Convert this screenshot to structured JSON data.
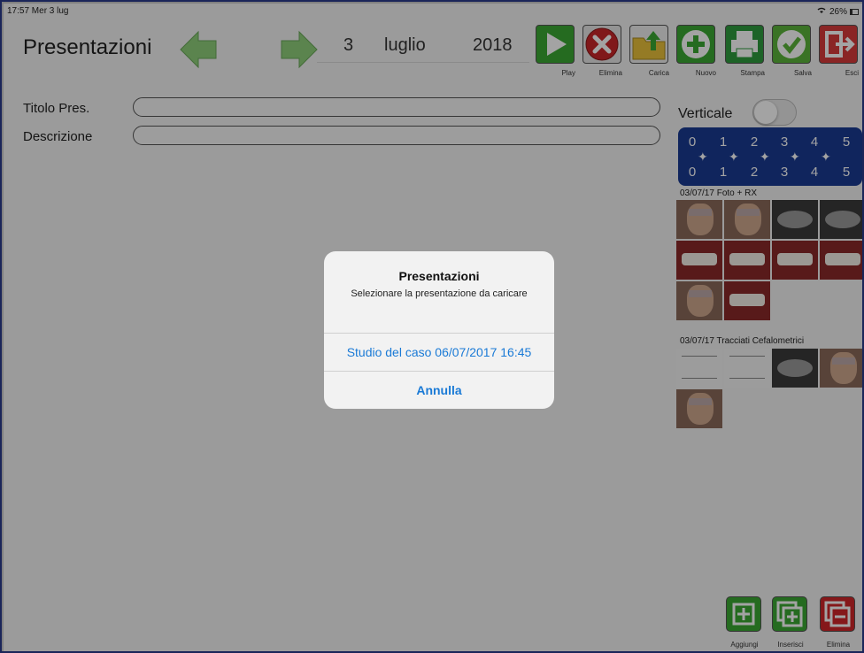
{
  "status": {
    "time_date": "17:57  Mer 3 lug",
    "battery": "26%"
  },
  "header": {
    "title": "Presentazioni",
    "day": "3",
    "month": "luglio",
    "year": "2018"
  },
  "toolbar": [
    {
      "label": "Play",
      "icon": "play-icon",
      "color": "#3aa832"
    },
    {
      "label": "Elimina",
      "icon": "delete-x-icon",
      "color": "#c8262a"
    },
    {
      "label": "Carica",
      "icon": "upload-folder-icon",
      "color": "#e9c13a"
    },
    {
      "label": "Nuovo",
      "icon": "plus-icon",
      "color": "#3aa832"
    },
    {
      "label": "Stampa",
      "icon": "printer-icon",
      "color": "#2e9b3e"
    },
    {
      "label": "Salva",
      "icon": "checkmark-icon",
      "color": "#5cb53a"
    },
    {
      "label": "Esci",
      "icon": "exit-icon",
      "color": "#d83a3a"
    }
  ],
  "form": {
    "title_label": "Titolo Pres.",
    "title_value": "",
    "description_label": "Descrizione",
    "description_value": ""
  },
  "sidebar": {
    "vertical_label": "Verticale",
    "vertical_on": false,
    "numpad_top": [
      "0",
      "1",
      "2",
      "3",
      "4",
      "5"
    ],
    "numpad_bottom": [
      "0",
      "1",
      "2",
      "3",
      "4",
      "5"
    ],
    "group1_title": "03/07/17 Foto + RX",
    "group2_title": "03/07/17 Tracciati Cefalometrici"
  },
  "bottom_buttons": [
    {
      "label": "Aggiungi",
      "icon": "add-square-icon",
      "color": "#3aa832"
    },
    {
      "label": "Inserisci",
      "icon": "insert-square-icon",
      "color": "#3aa832"
    },
    {
      "label": "Elimina",
      "icon": "remove-square-icon",
      "color": "#d0262a"
    }
  ],
  "alert": {
    "title": "Presentazioni",
    "message": "Selezionare la presentazione da caricare",
    "option": "Studio del caso 06/07/2017 16:45",
    "cancel": "Annulla"
  },
  "colors": {
    "accent_blue": "#1a7ad6",
    "numpad": "#1a3a92"
  }
}
